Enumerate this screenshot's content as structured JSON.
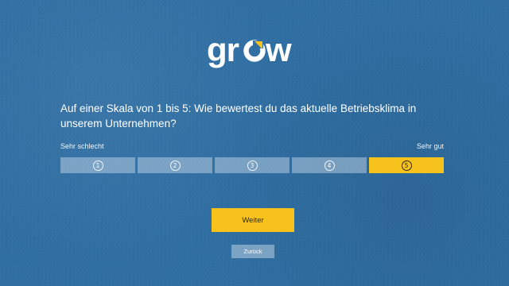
{
  "brand": {
    "logo_text": "grow",
    "accent_color": "#f7c21b",
    "background_color": "#2e6ea3"
  },
  "question": {
    "text": "Auf einer Skala von 1 bis 5: Wie bewertest du das aktuelle Betriebsklima in unserem Unternehmen?"
  },
  "scale": {
    "min_label": "Sehr schlecht",
    "max_label": "Sehr gut",
    "options": [
      {
        "label": "1",
        "selected": false
      },
      {
        "label": "2",
        "selected": false
      },
      {
        "label": "3",
        "selected": false
      },
      {
        "label": "4",
        "selected": false
      },
      {
        "label": "5",
        "selected": true
      }
    ]
  },
  "buttons": {
    "next_label": "Weiter",
    "back_label": "Zurück"
  }
}
